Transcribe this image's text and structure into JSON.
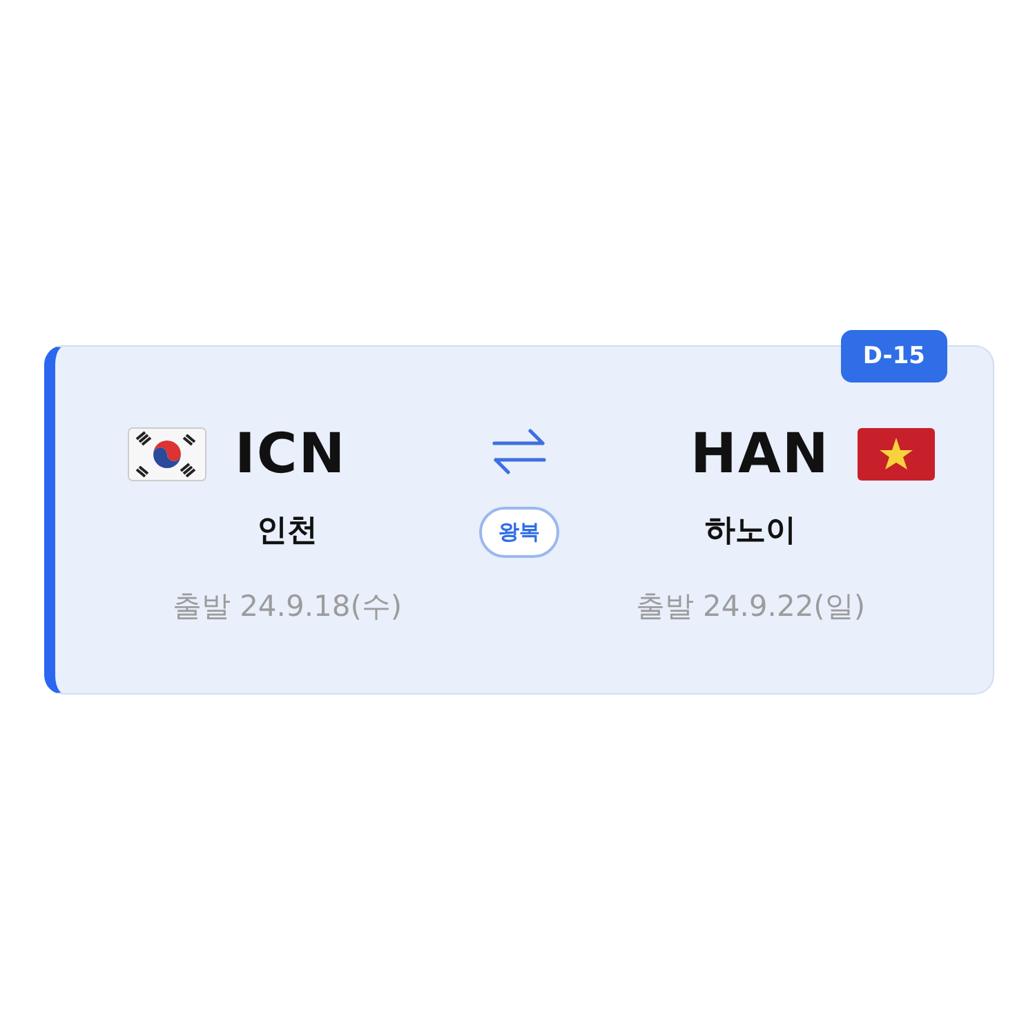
{
  "countdown": {
    "label": "D-15"
  },
  "origin": {
    "code": "ICN",
    "city": "인천",
    "date": "출발 24.9.18(수)"
  },
  "trip_type": {
    "label": "왕복"
  },
  "destination": {
    "code": "HAN",
    "city": "하노이",
    "date": "출발 24.9.22(일)"
  }
}
